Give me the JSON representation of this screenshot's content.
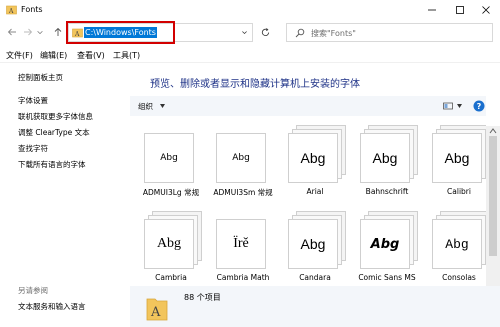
{
  "window": {
    "title": "Fonts",
    "icon": "fonts-folder-icon"
  },
  "address_bar": {
    "path": "C:\\Windows\\Fonts"
  },
  "search": {
    "placeholder": "搜索\"Fonts\""
  },
  "menu": [
    "文件(F)",
    "编辑(E)",
    "查看(V)",
    "工具(T)"
  ],
  "sidebar": {
    "home_link": "控制面板主页",
    "links": [
      "字体设置",
      "联机获取更多字体信息",
      "调整 ClearType 文本",
      "查找字符",
      "下载所有语言的字体"
    ],
    "see_also_header": "另请参阅",
    "see_also_links": [
      "文本服务和输入语言"
    ]
  },
  "main": {
    "heading": "预览、删除或者显示和隐藏计算机上安装的字体",
    "organize_label": "组织"
  },
  "fonts": [
    {
      "name": "ADMUI3Lg 常规",
      "sample": "Abg",
      "style": "small",
      "stack": false
    },
    {
      "name": "ADMUI3Sm 常规",
      "sample": "Abg",
      "style": "small",
      "stack": false
    },
    {
      "name": "Arial",
      "sample": "Abg",
      "style": "sans",
      "stack": true
    },
    {
      "name": "Bahnschrift",
      "sample": "Abg",
      "style": "sans",
      "stack": true
    },
    {
      "name": "Calibri",
      "sample": "Abg",
      "style": "sans",
      "stack": true
    },
    {
      "name": "Cambria",
      "sample": "Abg",
      "style": "serif",
      "stack": true
    },
    {
      "name": "Cambria Math",
      "sample": "Ïrě",
      "style": "serif",
      "stack": false
    },
    {
      "name": "Candara",
      "sample": "Abg",
      "style": "sans",
      "stack": true
    },
    {
      "name": "Comic Sans MS",
      "sample": "Abg",
      "style": "comic",
      "stack": true
    },
    {
      "name": "Consolas",
      "sample": "Abg",
      "style": "mono",
      "stack": true
    }
  ],
  "details": {
    "count_text": "88 个项目"
  },
  "colors": {
    "accent": "#0078d7",
    "heading": "#1e3287",
    "highlight_box": "#d20000",
    "pane_background": "#f3f6fa"
  }
}
